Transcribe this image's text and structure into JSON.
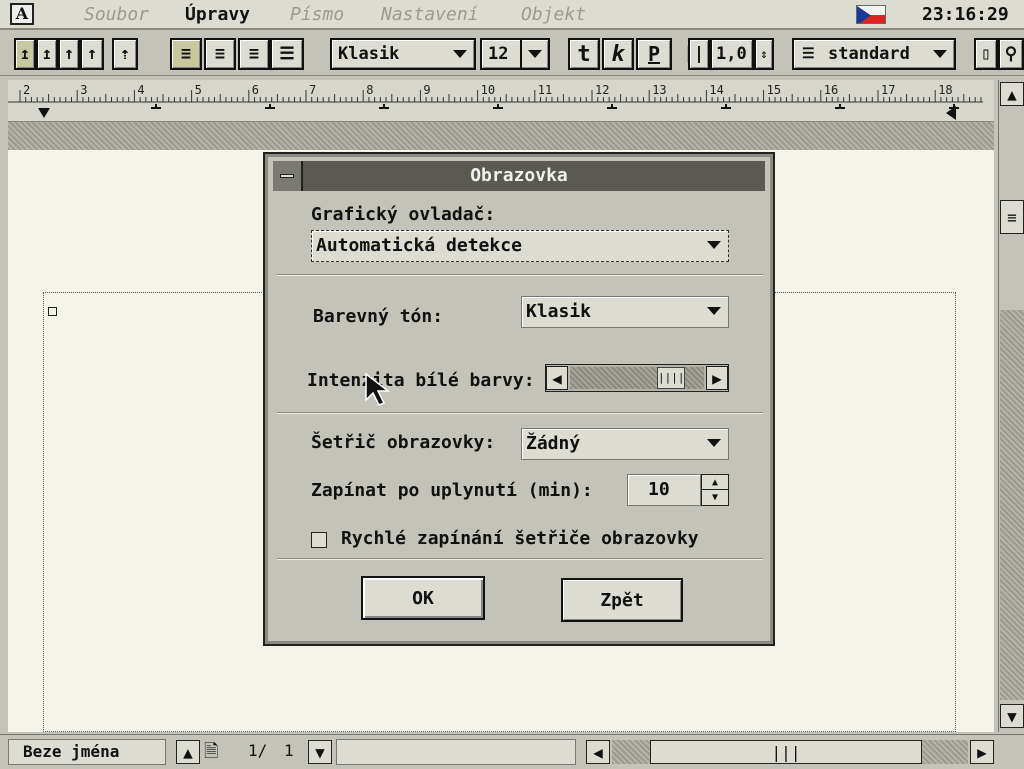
{
  "menubar": {
    "app_icon": "A",
    "items": [
      {
        "label": "Soubor",
        "enabled": false
      },
      {
        "label": "Úpravy",
        "enabled": true
      },
      {
        "label": "Písmo",
        "enabled": false
      },
      {
        "label": "Nastavení",
        "enabled": false
      },
      {
        "label": "Objekt",
        "enabled": false
      }
    ],
    "clock": "23:16:29",
    "flag_icon": "czech-flag-icon"
  },
  "toolbar": {
    "font_name": "Klasik",
    "font_size": "12",
    "bold_label": "t",
    "italic_label": "k",
    "underline_label": "P",
    "line_spacing": "1,0",
    "style_name": "standard"
  },
  "ruler": {
    "numbers": [
      "2",
      "3",
      "4",
      "5",
      "6",
      "7",
      "8",
      "9",
      "10",
      "11",
      "12",
      "13",
      "14",
      "15",
      "16",
      "17",
      "18"
    ]
  },
  "dialog": {
    "title": "Obrazovka",
    "graphics_driver_label": "Grafický ovladač:",
    "graphics_driver_value": "Automatická detekce",
    "color_tone_label": "Barevný tón:",
    "color_tone_value": "Klasik",
    "white_intensity_label": "Intenzita bílé barvy:",
    "white_intensity_level": 0.82,
    "screensaver_label": "Šetřič obrazovky:",
    "screensaver_value": "Žádný",
    "delay_label": "Zapínat po uplynutí (min):",
    "delay_value": "10",
    "quick_start_label": "Rychlé zapínání šetřiče obrazovky",
    "quick_start_checked": false,
    "ok_label": "OK",
    "back_label": "Zpět"
  },
  "statusbar": {
    "doc_name": "Beze jména",
    "page_current": "1/",
    "page_total": "1"
  }
}
